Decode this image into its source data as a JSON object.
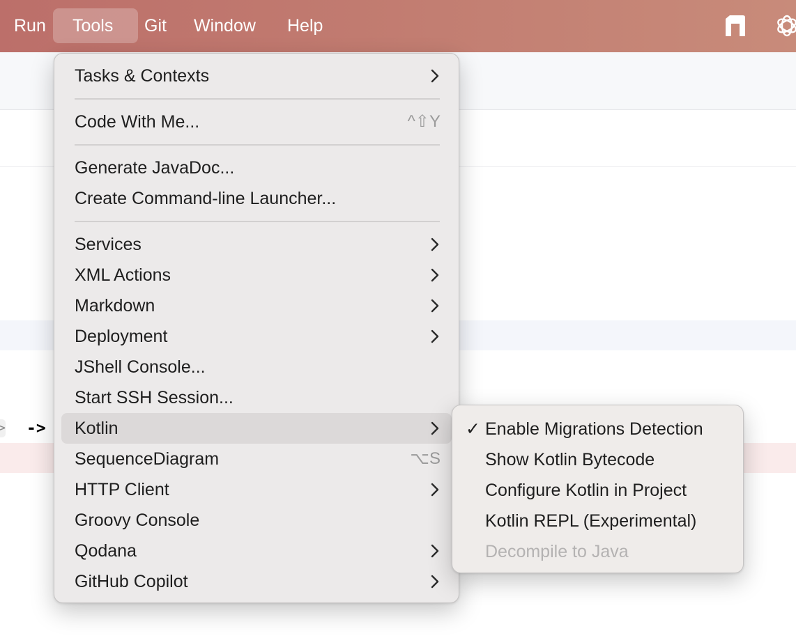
{
  "menubar": {
    "items": [
      "Run",
      "Tools",
      "Git",
      "Window",
      "Help"
    ],
    "active": "Tools",
    "tray_icons": [
      "notion-icon",
      "chatgpt-icon"
    ]
  },
  "editor": {
    "code_fragment": "->"
  },
  "tools_menu": {
    "items": [
      {
        "label": "Tasks & Contexts",
        "submenu": true
      },
      {
        "label": "Code With Me...",
        "shortcut": "^⇧Y"
      },
      {
        "label": "Generate JavaDoc..."
      },
      {
        "label": "Create Command-line Launcher..."
      },
      {
        "label": "Services",
        "submenu": true
      },
      {
        "label": "XML Actions",
        "submenu": true
      },
      {
        "label": "Markdown",
        "submenu": true
      },
      {
        "label": "Deployment",
        "submenu": true
      },
      {
        "label": "JShell Console..."
      },
      {
        "label": "Start SSH Session..."
      },
      {
        "label": "Kotlin",
        "submenu": true,
        "selected": true
      },
      {
        "label": "SequenceDiagram",
        "shortcut": "⌥S"
      },
      {
        "label": "HTTP Client",
        "submenu": true
      },
      {
        "label": "Groovy Console"
      },
      {
        "label": "Qodana",
        "submenu": true
      },
      {
        "label": "GitHub Copilot",
        "submenu": true
      }
    ]
  },
  "kotlin_submenu": {
    "items": [
      {
        "label": "Enable Migrations Detection",
        "checked": true,
        "check_mark": "✓"
      },
      {
        "label": "Show Kotlin Bytecode"
      },
      {
        "label": "Configure Kotlin in Project"
      },
      {
        "label": "Kotlin REPL (Experimental)"
      },
      {
        "label": "Decompile to Java",
        "disabled": true
      }
    ]
  },
  "colors": {
    "menubar_gradient_start": "#bc6f6a",
    "menubar_gradient_end": "#c88b7a",
    "menu_background": "#eceaea",
    "selected_item": "#dcd9d9",
    "disabled_text": "#b4b2b2"
  }
}
